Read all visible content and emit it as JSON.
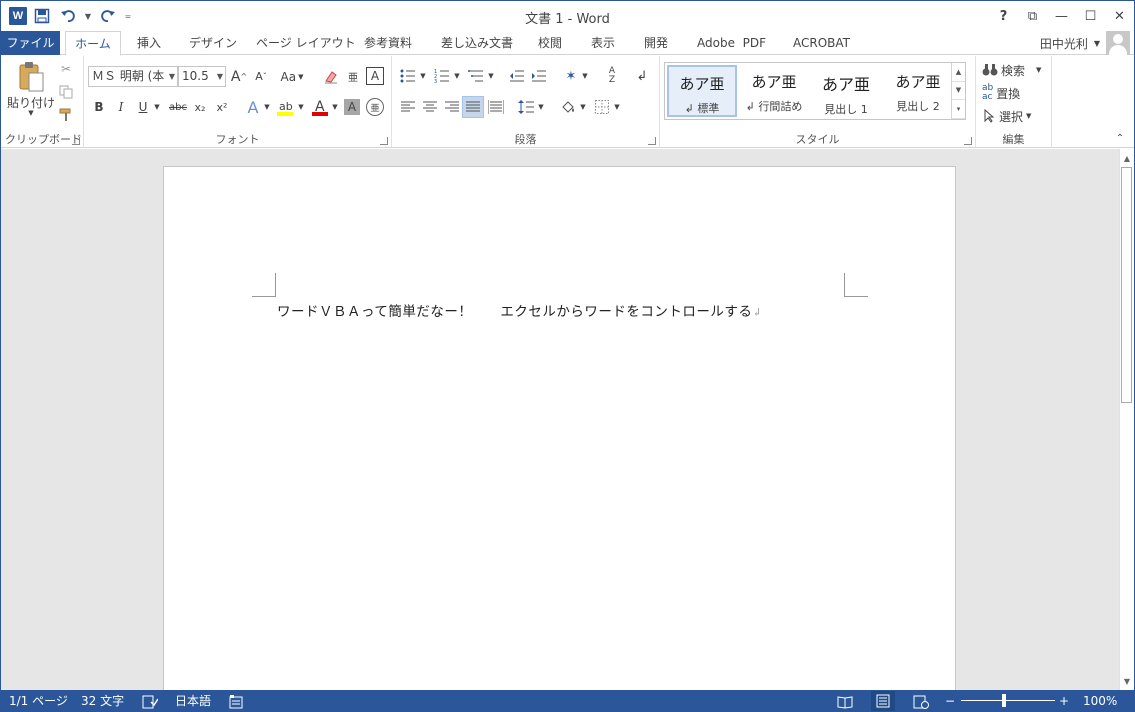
{
  "app": {
    "title": "文書 1 - Word",
    "logo_letter": "W"
  },
  "qat": {
    "customize_glyph": "="
  },
  "window_controls": {
    "help": "?",
    "ribbon_display": "⧉",
    "minimize": "—",
    "maximize": "☐",
    "close": "✕"
  },
  "tabs": [
    "ファイル",
    "ホーム",
    "挿入",
    "デザイン",
    "ページ レイアウト",
    "参考資料",
    "差し込み文書",
    "校閲",
    "表示",
    "開発",
    "Adobe  PDF",
    "ACROBAT"
  ],
  "user": {
    "name": "田中光利"
  },
  "clipboard": {
    "paste_label": "貼り付け",
    "group_label": "クリップボード"
  },
  "font": {
    "name": "ＭＳ 明朝 (本",
    "size": "10.5",
    "grow": "A",
    "shrink": "A",
    "case": "Aa",
    "bold": "B",
    "italic": "I",
    "underline": "U",
    "strike": "abc",
    "subscript": "x₂",
    "superscript": "x²",
    "color_letter": "A",
    "ruby": "亜",
    "group_label": "フォント"
  },
  "paragraph": {
    "group_label": "段落"
  },
  "styles": {
    "items": [
      {
        "preview": "あア亜",
        "name": "↲ 標準"
      },
      {
        "preview": "あア亜",
        "name": "↲ 行間詰め"
      },
      {
        "preview": "あア亜",
        "name": "見出し 1"
      },
      {
        "preview": "あア亜",
        "name": "見出し 2"
      }
    ],
    "group_label": "スタイル"
  },
  "editing": {
    "find": "検索",
    "replace": "置換",
    "select": "選択",
    "group_label": "編集"
  },
  "document": {
    "text": "ワードＶＢＡって簡単だなー！　　エクセルからワードをコントロールする",
    "para_mark": "↲"
  },
  "status": {
    "page": "1/1 ページ",
    "words": "32 文字",
    "language": "日本語",
    "zoom": "100%",
    "zoom_minus": "−",
    "zoom_plus": "+"
  },
  "colors": {
    "accent": "#2b579a",
    "highlight": "#ffff00",
    "font_color": "#e00000"
  }
}
